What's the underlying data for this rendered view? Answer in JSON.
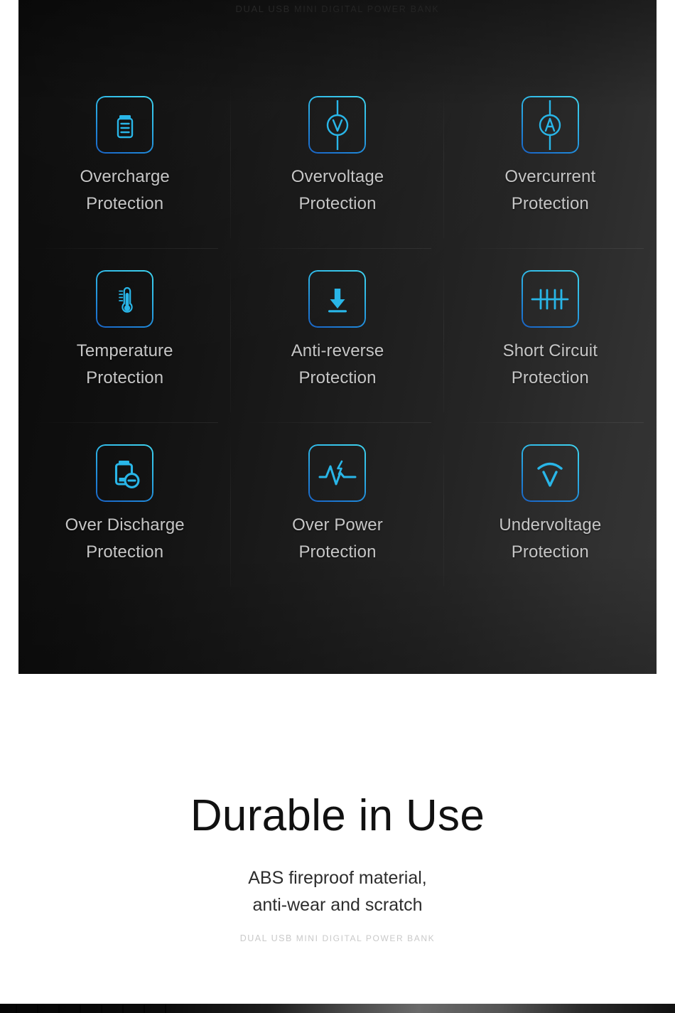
{
  "panel": {
    "brand": {
      "line1": "DUAL USB",
      "line2": "MINI DIGITAL POWER BANK"
    },
    "features": [
      {
        "icon": "battery-icon",
        "line1": "Overcharge",
        "line2": "Protection"
      },
      {
        "icon": "voltmeter-icon",
        "line1": "Overvoltage",
        "line2": "Protection"
      },
      {
        "icon": "ammeter-icon",
        "line1": "Overcurrent",
        "line2": "Protection"
      },
      {
        "icon": "thermometer-icon",
        "line1": "Temperature",
        "line2": "Protection"
      },
      {
        "icon": "down-arrow-line-icon",
        "line1": "Anti-reverse",
        "line2": "Protection"
      },
      {
        "icon": "short-circuit-icon",
        "line1": "Short Circuit",
        "line2": "Protection"
      },
      {
        "icon": "battery-minus-icon",
        "line1": "Over Discharge",
        "line2": "Protection"
      },
      {
        "icon": "waveform-bolt-icon",
        "line1": "Over Power",
        "line2": "Protection"
      },
      {
        "icon": "undervoltage-v-icon",
        "line1": "Undervoltage",
        "line2": "Protection"
      }
    ]
  },
  "durable": {
    "title": "Durable in Use",
    "subtitle_line1": "ABS fireproof material,",
    "subtitle_line2": "anti-wear and scratch",
    "brand": {
      "line1": "DUAL USB",
      "line2": "MINI DIGITAL POWER BANK"
    }
  },
  "colors": {
    "icon_cyan": "#3fd3ef",
    "icon_blue": "#1a63c4",
    "caption_gray": "#c6c6c6",
    "panel_dark": "#0a0a0a",
    "panel_light": "#353535"
  }
}
